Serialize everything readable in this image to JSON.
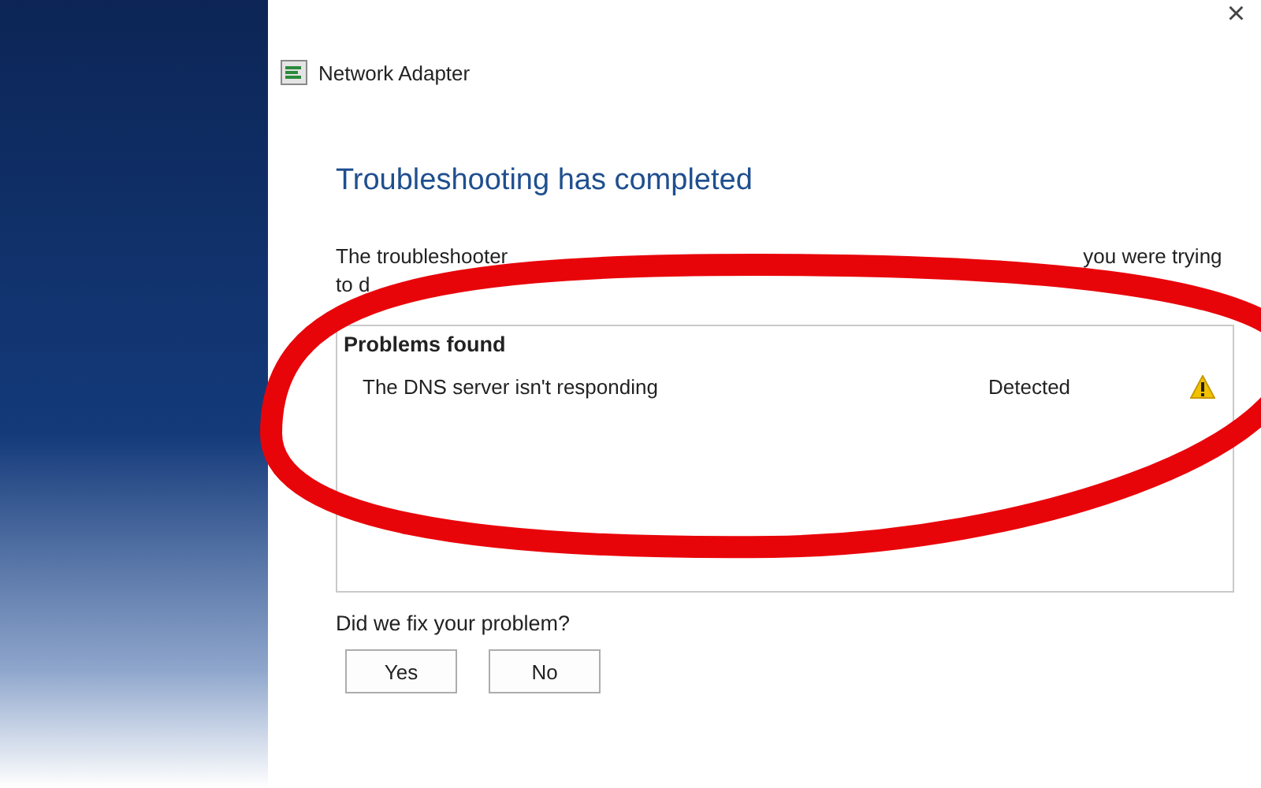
{
  "window": {
    "title": "Network Adapter",
    "close": "×"
  },
  "heading": "Troubleshooting has completed",
  "description_lines": [
    [
      "The troubleshooter",
      "you were trying"
    ],
    [
      "to d"
    ]
  ],
  "problems": {
    "title": "Problems found",
    "items": [
      {
        "name": "The DNS server isn't responding",
        "status": "Detected",
        "kind": "warning"
      }
    ]
  },
  "question": "Did we fix your problem?",
  "buttons": [
    "Yes",
    "No"
  ]
}
